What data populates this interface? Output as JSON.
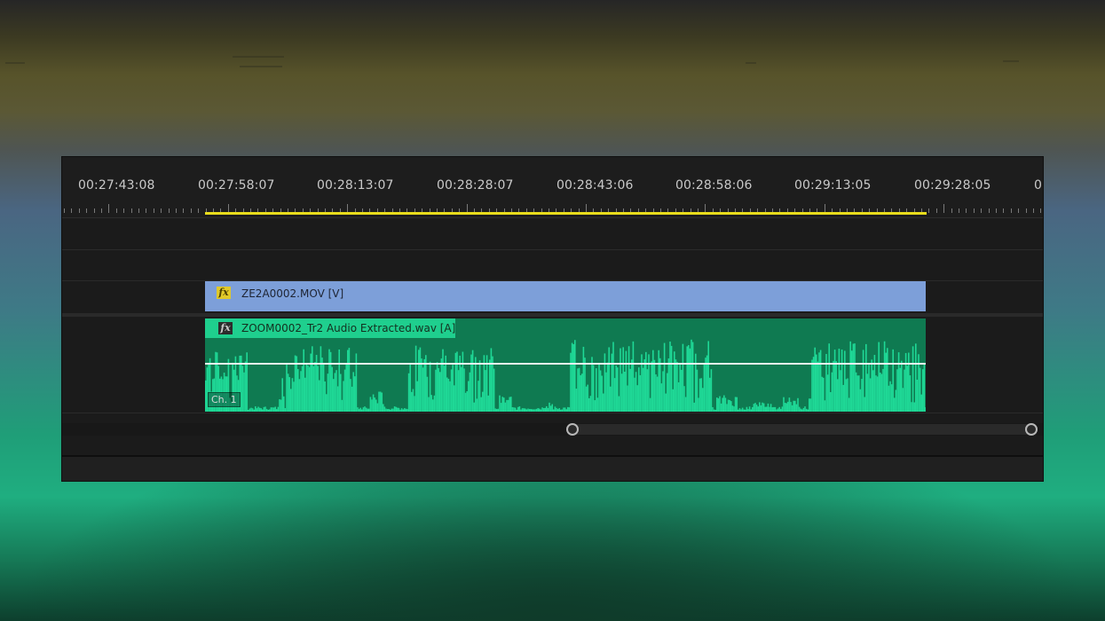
{
  "timeline": {
    "timecodes": [
      "00:27:43:08",
      "00:27:58:07",
      "00:28:13:07",
      "00:28:28:07",
      "00:28:43:06",
      "00:28:58:06",
      "00:29:13:05",
      "00:29:28:05",
      "0"
    ]
  },
  "video_clip": {
    "fx_label": "fx",
    "name": "ZE2A0002.MOV [V]"
  },
  "audio_clip": {
    "fx_label": "fx",
    "name": "ZOOM0002_Tr2 Audio Extracted.wav [A]",
    "channel": "Ch. 1"
  },
  "colors": {
    "work_area": "#e8dc1c",
    "video_clip": "#7d9fd9",
    "audio_clip": "#0f7a51",
    "waveform": "#1fd896",
    "panel": "#1b1b1b"
  }
}
